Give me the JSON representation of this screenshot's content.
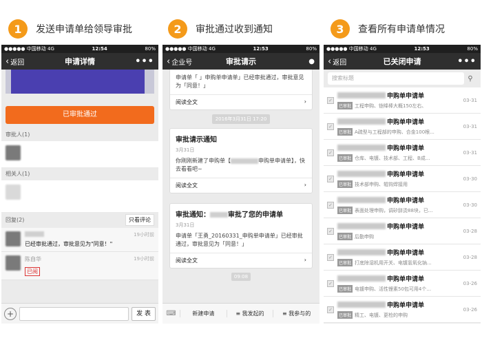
{
  "steps": [
    {
      "num": "1",
      "label": "发送申请单给领导审批"
    },
    {
      "num": "2",
      "label": "审批通过收到通知"
    },
    {
      "num": "3",
      "label": "查看所有申请单情况"
    }
  ],
  "colors": {
    "step_badge": "#f49a1a",
    "approve_button": "#f26b1d",
    "navbar": "#2f2f2f"
  },
  "status": {
    "carrier": "●●●●● 中国移动  4G",
    "time": "12:54",
    "time2": "12:53",
    "time3": "12:53",
    "battery": "80%"
  },
  "phone1": {
    "back": "返回",
    "title": "申请详情",
    "menu": "•••",
    "approve_label": "已审批通过",
    "approver_label": "审批人(1)",
    "related_label": "相关人(1)",
    "reply_label": "回复(2)",
    "only_comments": "只看评论",
    "comments": [
      {
        "time": "19小时前",
        "text": "已经审批通过，审批意见为\"同意！\""
      },
      {
        "name": "陈自华",
        "time": "19小时前",
        "stamp": "已阅"
      }
    ],
    "plus": "+",
    "send": "发 表"
  },
  "phone2": {
    "back": "企业号",
    "title": "审批请示",
    "readall": "阅读全文",
    "timestamp": "2016年3月31日 17:20",
    "timestamp2": "09:08",
    "card_top_body": "申请单「 」申购单申请单」已经审批通过，审批意见为「同意！」",
    "card1": {
      "title": "审批请示通知",
      "date": "3月31日",
      "body_pre": "你刚刚新建了申购单【",
      "body_post": "申购单申请单】，快去看看吧~"
    },
    "card2": {
      "title_pre": "审批通知：",
      "title_post": "审批了您的申请单",
      "date": "3月31日",
      "body": "申请单「王勇_20160331_申购单申请单」已经审批通过，审批意见为「同意！」"
    },
    "tabs": [
      "新建申请",
      "≡ 我发起的",
      "≡ 我参与的"
    ]
  },
  "phone3": {
    "back": "返回",
    "title": "已关闭申请",
    "menu": "•••",
    "search_placeholder": "搜索标题",
    "tag": "已审批",
    "rows": [
      {
        "title": "申购单申请单",
        "sub": "工程申购、铠绛棒大概150左右、",
        "date": "03-31"
      },
      {
        "title": "申购单申请单",
        "sub": "A疏型与工程部的申购、合金100根...",
        "date": "03-31"
      },
      {
        "title": "申购单申请单",
        "sub": "仓库、电镀、技术部、工程、B成...",
        "date": "03-31"
      },
      {
        "title": "申购单申请单",
        "sub": "技术部申购、辊钩焊接用",
        "date": "03-30"
      },
      {
        "title": "申购单申请单",
        "sub": "表面处理申购，调矽辞烫88块，已...",
        "date": "03-30"
      },
      {
        "title": "申购单申请单",
        "sub": "后勤申购",
        "date": "03-28"
      },
      {
        "title": "申购单申请单",
        "sub": "打底除湿机用开关、电镀氢氧化钠...",
        "date": "03-28"
      },
      {
        "title": "申购单申请单",
        "sub": "电镀申购、活性锂素50包可用4个...",
        "date": "03-26"
      },
      {
        "title": "申购单申请单",
        "sub": "精工、电镀、更检的申购",
        "date": "03-26"
      }
    ]
  }
}
